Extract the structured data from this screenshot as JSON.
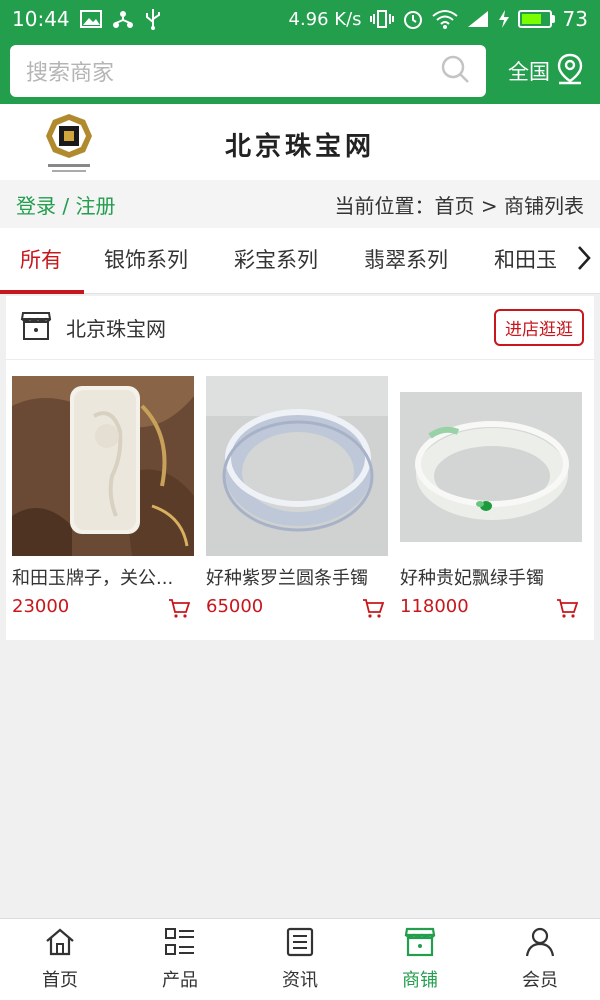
{
  "status_bar": {
    "time": "10:44",
    "speed": "4.96 K/s",
    "battery_level": "73",
    "battery_fraction": 0.73,
    "icons": [
      "image-icon",
      "usb-tether-icon",
      "usb-icon",
      "vibrate-icon",
      "alarm-icon",
      "wifi-icon",
      "signal-4g-icon",
      "charging-icon"
    ]
  },
  "search": {
    "placeholder": "搜索商家",
    "region_label": "全国"
  },
  "header": {
    "site_title": "北京珠宝网"
  },
  "crumb_bar": {
    "login_register": "登录 / 注册",
    "location": "当前位置：首页 > 商铺列表"
  },
  "tabs": [
    {
      "label": "所有",
      "active": true
    },
    {
      "label": "银饰系列",
      "active": false
    },
    {
      "label": "彩宝系列",
      "active": false
    },
    {
      "label": "翡翠系列",
      "active": false
    },
    {
      "label": "和田玉",
      "active": false
    }
  ],
  "shop": {
    "name": "北京珠宝网",
    "visit_label": "进店逛逛",
    "products": [
      {
        "name": "和田玉牌子，关公...",
        "price": "23000"
      },
      {
        "name": "好种紫罗兰圆条手镯",
        "price": "65000"
      },
      {
        "name": "好种贵妃飘绿手镯",
        "price": "118000"
      }
    ]
  },
  "bottom_nav": [
    {
      "label": "首页",
      "icon": "home-icon",
      "active": false
    },
    {
      "label": "产品",
      "icon": "list-icon",
      "active": false
    },
    {
      "label": "资讯",
      "icon": "news-icon",
      "active": false
    },
    {
      "label": "商铺",
      "icon": "shop-icon",
      "active": true
    },
    {
      "label": "会员",
      "icon": "user-icon",
      "active": false
    }
  ],
  "colors": {
    "brand_green": "#229e4d",
    "accent_red": "#c7171d"
  }
}
